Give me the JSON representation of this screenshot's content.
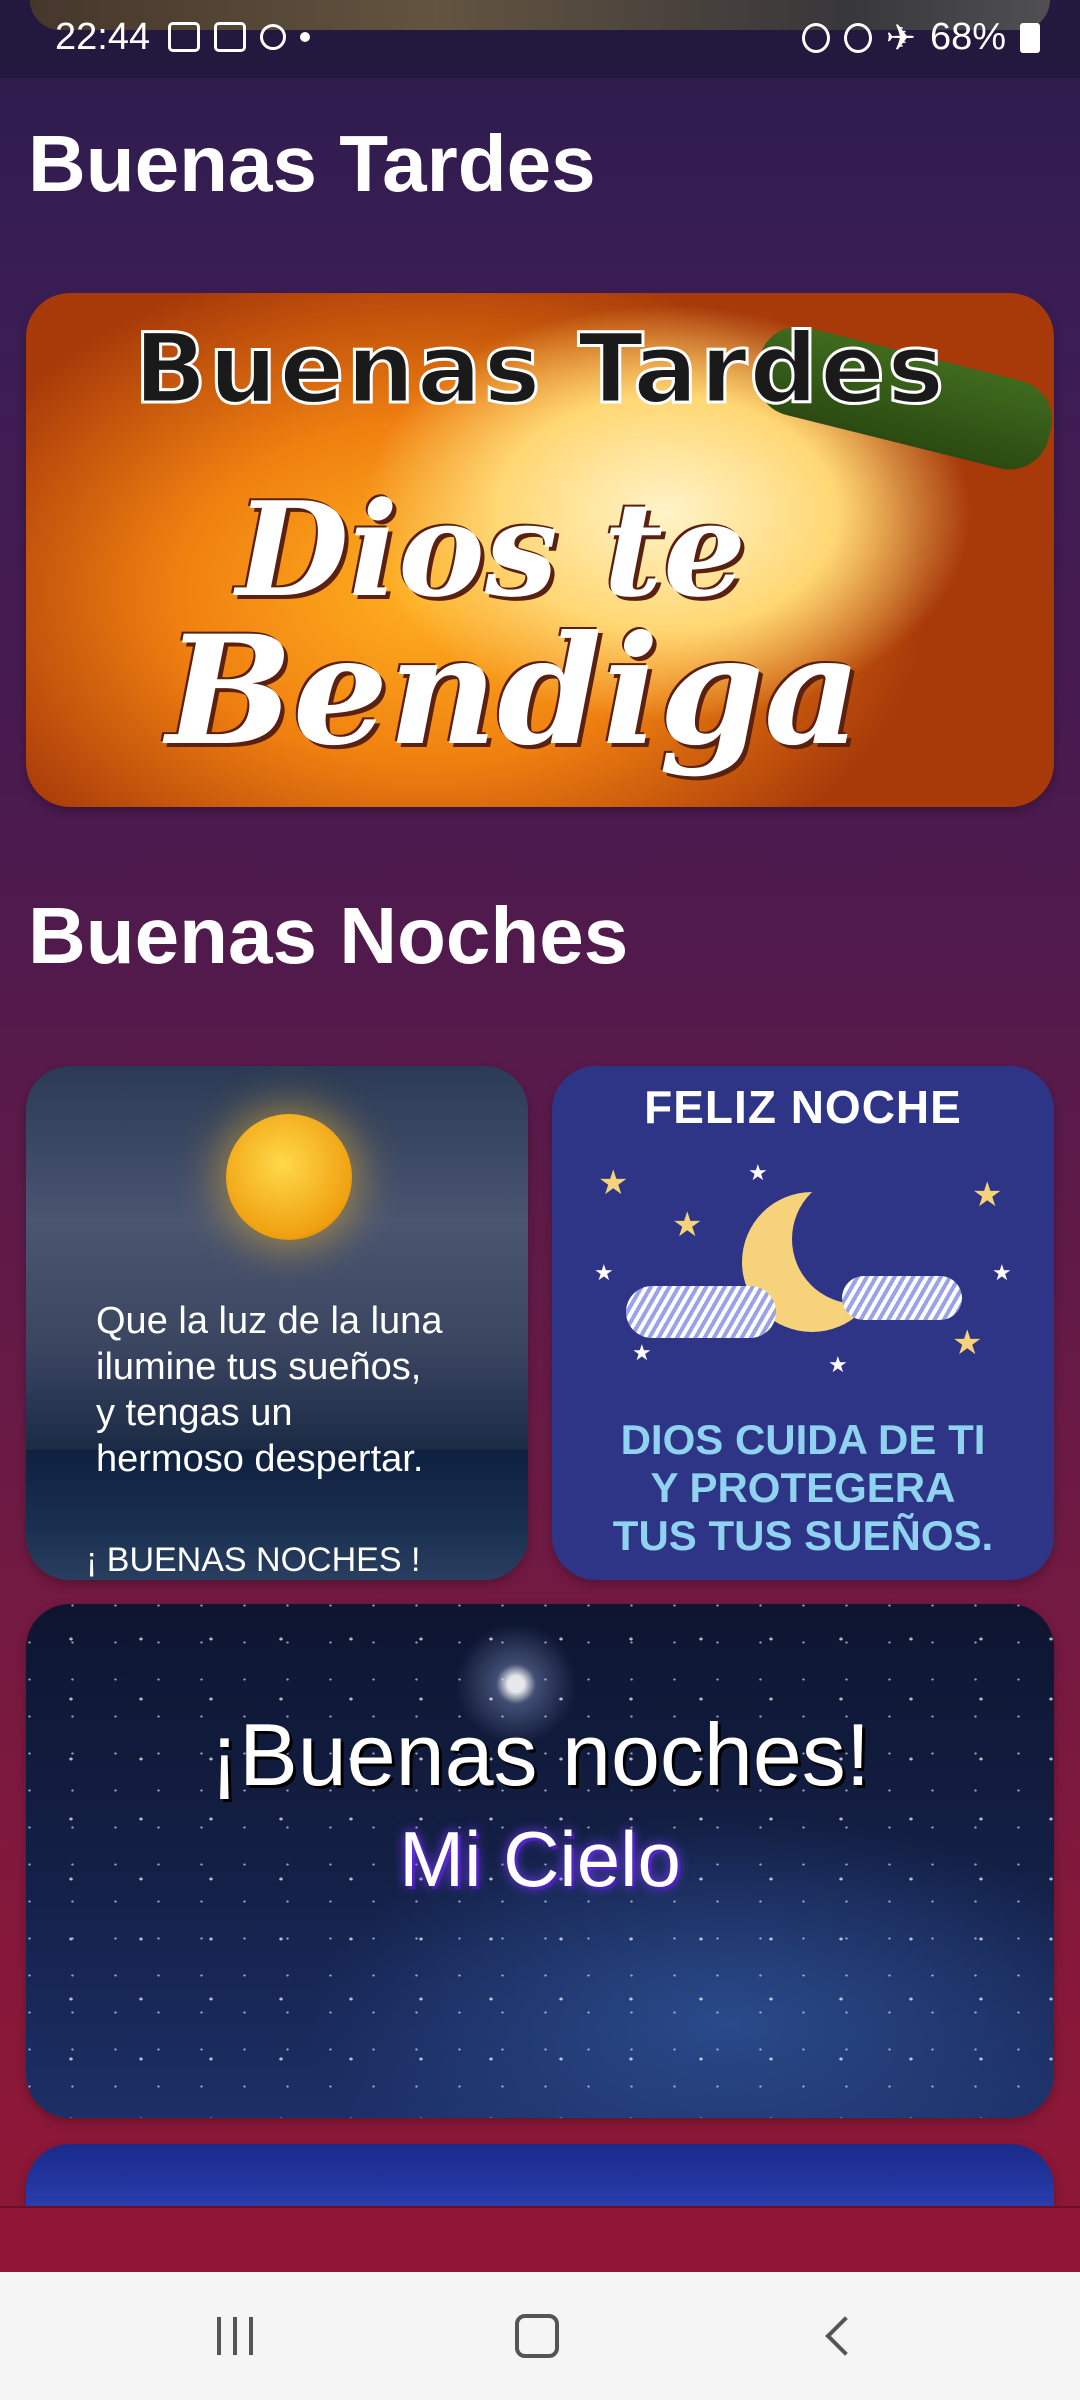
{
  "status_bar": {
    "time": "22:44",
    "battery": "68%",
    "left_icons": [
      "gallery-icon",
      "voicemail-icon",
      "app-icon",
      "notification-dot"
    ],
    "right_icons": [
      "data-saver-icon",
      "alarm-icon",
      "airplane-icon",
      "battery-icon"
    ]
  },
  "sections": {
    "tardes": {
      "title": "Buenas Tardes",
      "card": {
        "line1": "Buenas Tardes",
        "line2": "Dios te",
        "line3": "Bendiga"
      }
    },
    "noches": {
      "title": "Buenas Noches",
      "card_luna": {
        "quote": "Que la luz de la luna\nilumine tus sueños,\ny tengas un\nhermoso despertar.",
        "sign": "¡ BUENAS NOCHES !"
      },
      "card_feliz": {
        "title": "FELIZ NOCHE",
        "body": "DIOS CUIDA DE TI\nY PROTEGERA\nTUS TUS SUEÑOS."
      },
      "card_cielo": {
        "line1": "¡Buenas noches!",
        "line2": "Mi Cielo"
      }
    }
  },
  "nav_bar": {
    "buttons": [
      "recents-icon",
      "home-icon",
      "back-icon"
    ]
  }
}
